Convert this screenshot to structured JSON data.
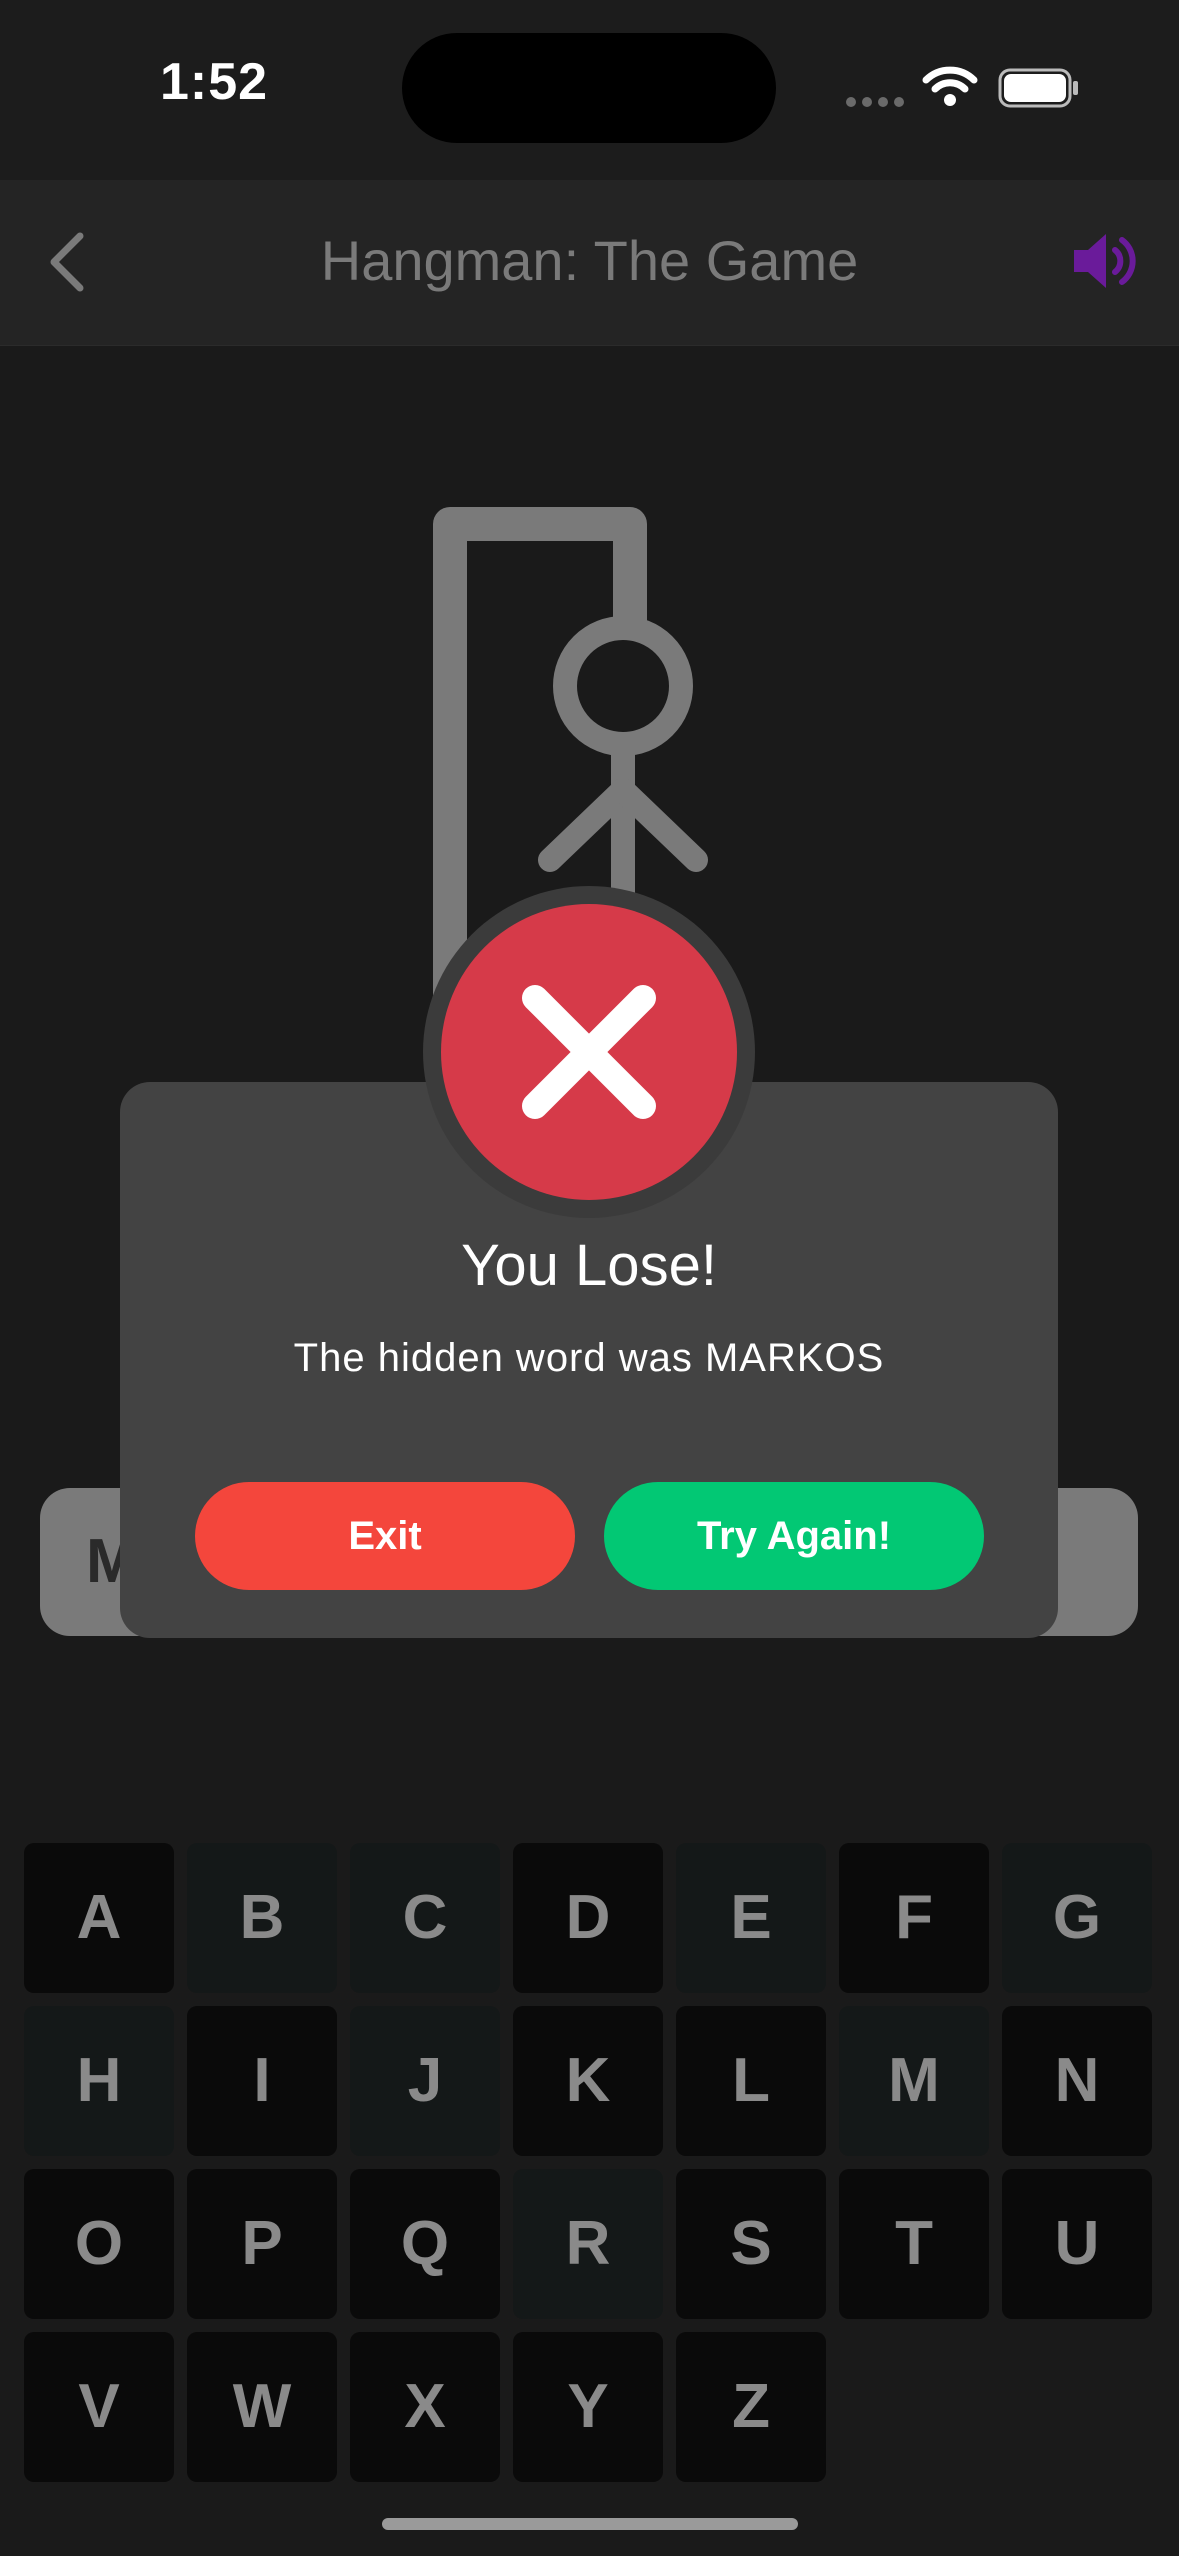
{
  "status_bar": {
    "time": "1:52"
  },
  "header": {
    "title": "Hangman: The Game",
    "accent_color": "#6a1b9a"
  },
  "word": {
    "first_letter": "M"
  },
  "dialog": {
    "title": "You Lose!",
    "message": "The hidden word was MARKOS",
    "exit_label": "Exit",
    "retry_label": "Try Again!"
  },
  "keyboard": {
    "rows": [
      [
        {
          "letter": "A",
          "used": true
        },
        {
          "letter": "B",
          "used": false
        },
        {
          "letter": "C",
          "used": false
        },
        {
          "letter": "D",
          "used": true
        },
        {
          "letter": "E",
          "used": false
        },
        {
          "letter": "F",
          "used": true
        },
        {
          "letter": "G",
          "used": false
        }
      ],
      [
        {
          "letter": "H",
          "used": false
        },
        {
          "letter": "I",
          "used": true
        },
        {
          "letter": "J",
          "used": false
        },
        {
          "letter": "K",
          "used": true
        },
        {
          "letter": "L",
          "used": true
        },
        {
          "letter": "M",
          "used": false
        },
        {
          "letter": "N",
          "used": true
        }
      ],
      [
        {
          "letter": "O",
          "used": true
        },
        {
          "letter": "P",
          "used": true
        },
        {
          "letter": "Q",
          "used": true
        },
        {
          "letter": "R",
          "used": false
        },
        {
          "letter": "S",
          "used": true
        },
        {
          "letter": "T",
          "used": true
        },
        {
          "letter": "U",
          "used": true
        }
      ],
      [
        {
          "letter": "V",
          "used": true
        },
        {
          "letter": "W",
          "used": true
        },
        {
          "letter": "X",
          "used": true
        },
        {
          "letter": "Y",
          "used": true
        },
        {
          "letter": "Z",
          "used": true
        }
      ]
    ]
  }
}
